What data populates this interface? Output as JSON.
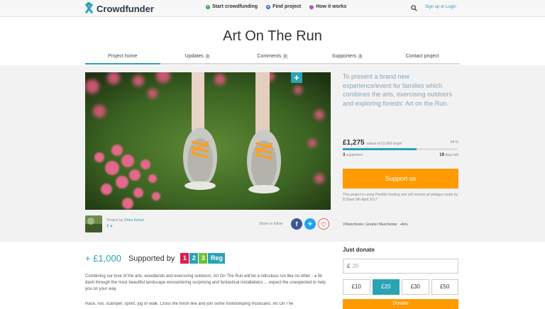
{
  "nav": {
    "brand": "Crowdfunder",
    "links": [
      {
        "label": "Start crowdfunding",
        "icon": "plus-circle-icon",
        "color": "#34a853"
      },
      {
        "label": "Find project",
        "icon": "find-icon",
        "color": "#2a6fd6"
      },
      {
        "label": "How it works",
        "icon": "question-icon",
        "color": "#9b4bb0"
      }
    ],
    "signup": "Sign up",
    "or": "or",
    "login": "Login"
  },
  "project": {
    "title": "Art On The Run",
    "tabs": [
      {
        "label": "Project home",
        "count": ""
      },
      {
        "label": "Updates",
        "count": "0"
      },
      {
        "label": "Comments",
        "count": "0"
      },
      {
        "label": "Supporters",
        "count": "3"
      },
      {
        "label": "Contact project",
        "count": ""
      }
    ],
    "blurb": "To present a brand new experience/event for families which combines the arts, exercising outdoors and exploring forests: Art on the Run.",
    "raised": "£1,275",
    "raised_suffix": "raised of £2,000 target",
    "percent": "64 %",
    "percent_value": 64,
    "supporters": "3",
    "supporters_label": "supporters",
    "days": "19",
    "days_label": "days left",
    "support_button": "Support us",
    "funding_note": "This project is using Flexible funding and will receive all pledges made by 8:30am 5th April 2017",
    "location": "Manchester, Greater Manchester",
    "category": "Arts"
  },
  "creator": {
    "prefix": "Project by",
    "name": "Olivia Kehoe",
    "social": "f",
    "share_label": "Share or follow"
  },
  "pledge": {
    "amount": "+ £1,000",
    "supported_by": "Supported by",
    "sponsor_digits": [
      "1",
      "2",
      "3"
    ],
    "sponsor_word": "Reg",
    "colors": [
      "#e5194e",
      "#2aa3b5",
      "#6fbf3b"
    ]
  },
  "description": {
    "p1": "Combining our love of the arts, woodlands and exercising outdoors, Art On The Run will be a ridiculous run like no other - a 5k dash through the most beautiful landscape encountering surprising and fantastical installations ... expect the unexpected to help you on your way.",
    "p2": "Race, run, scamper, sprint, jog or walk. Cross the finish line and join some footstomping musicians. Art On The"
  },
  "donate": {
    "heading": "Just donate",
    "currency": "£",
    "placeholder": "20",
    "amounts": [
      "£10",
      "£20",
      "£30",
      "£50"
    ],
    "selected": "£20",
    "button": "Donate"
  }
}
